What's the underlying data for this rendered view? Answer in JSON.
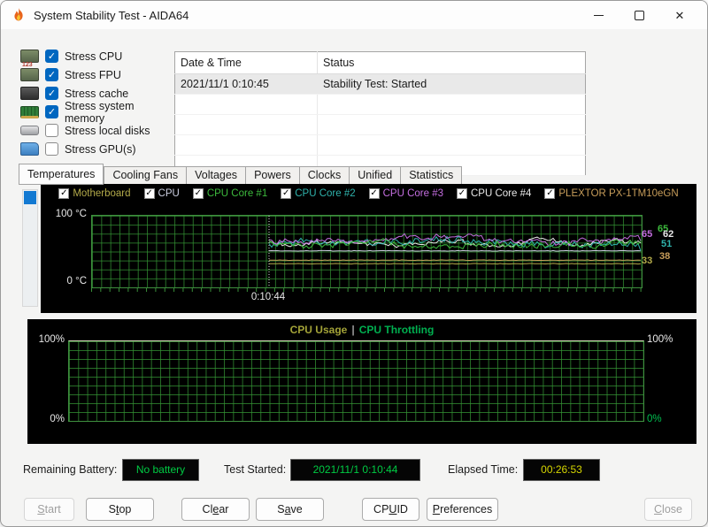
{
  "window": {
    "title": "System Stability Test - AIDA64"
  },
  "glyphs": {
    "check": "✓",
    "close": "✕"
  },
  "colors": {
    "accent_blue": "#0067c0",
    "panel_bg": "#000000",
    "grid_green": "#349434",
    "usage_title_olive": "#a3a338",
    "throttling_green": "#00b050",
    "status_value_green": "#00cc44",
    "status_value_yellow": "#d6d600"
  },
  "stress_options": [
    {
      "label": "Stress CPU",
      "checked": true,
      "icon": "cpu-icon"
    },
    {
      "label": "Stress FPU",
      "checked": true,
      "icon": "fpu-icon"
    },
    {
      "label": "Stress cache",
      "checked": true,
      "icon": "cache-icon"
    },
    {
      "label": "Stress system memory",
      "checked": true,
      "icon": "memory-icon"
    },
    {
      "label": "Stress local disks",
      "checked": false,
      "icon": "disk-icon"
    },
    {
      "label": "Stress GPU(s)",
      "checked": false,
      "icon": "gpu-icon"
    }
  ],
  "log_table": {
    "columns": [
      "Date & Time",
      "Status"
    ],
    "rows": [
      {
        "datetime": "2021/11/1 0:10:45",
        "status": "Stability Test: Started",
        "selected": true
      }
    ]
  },
  "tabs": {
    "active": "Temperatures",
    "items": [
      "Temperatures",
      "Cooling Fans",
      "Voltages",
      "Powers",
      "Clocks",
      "Unified",
      "Statistics"
    ]
  },
  "chart_data": [
    {
      "type": "line",
      "title": "Temperatures",
      "y_axis": {
        "max_label": "100 °C",
        "min_label": "0 °C",
        "min": 0,
        "max": 100
      },
      "x_axis": {
        "start_marker": "0:10:44"
      },
      "legend_position": "top",
      "grid": true,
      "legend": [
        {
          "label": "Motherboard",
          "color": "#b3aa4a",
          "checked": true
        },
        {
          "label": "CPU",
          "color": "#cdd0e2",
          "checked": true
        },
        {
          "label": "CPU Core #1",
          "color": "#3dbb3d",
          "checked": true
        },
        {
          "label": "CPU Core #2",
          "color": "#2fb3ac",
          "checked": true
        },
        {
          "label": "CPU Core #3",
          "color": "#c46ee0",
          "checked": true
        },
        {
          "label": "CPU Core #4",
          "color": "#e8e8e8",
          "checked": true
        },
        {
          "label": "PLEXTOR PX-1TM10eGN",
          "color": "#c79d5a",
          "checked": true
        }
      ],
      "series": [
        {
          "name": "Motherboard",
          "color": "#b3aa4a",
          "pattern": "flat",
          "value": 33,
          "end": 33
        },
        {
          "name": "CPU",
          "color": "#cdd0e2",
          "pattern": "flat",
          "value": 51,
          "end": 51
        },
        {
          "name": "CPU Core #1",
          "color": "#3dbb3d",
          "pattern": "noisy",
          "mean": 64,
          "amplitude": 7,
          "end": 65
        },
        {
          "name": "CPU Core #2",
          "color": "#2fb3ac",
          "pattern": "noisy",
          "mean": 61,
          "amplitude": 7,
          "end": 51
        },
        {
          "name": "CPU Core #3",
          "color": "#c46ee0",
          "pattern": "noisy",
          "mean": 66,
          "amplitude": 6,
          "end": 65
        },
        {
          "name": "CPU Core #4",
          "color": "#e8e8e8",
          "pattern": "noisy",
          "mean": 63,
          "amplitude": 5,
          "end": 62
        },
        {
          "name": "PLEXTOR PX-1TM10eGN",
          "color": "#c79d5a",
          "pattern": "flat",
          "value": 38,
          "end": 38
        }
      ],
      "end_labels": [
        {
          "text": "65",
          "color": "#c46ee0"
        },
        {
          "text": "65",
          "color": "#3dbb3d"
        },
        {
          "text": "62",
          "color": "#e8e8e8"
        },
        {
          "text": "51",
          "color": "#2fb3ac"
        },
        {
          "text": "38",
          "color": "#c79d5a"
        },
        {
          "text": "33",
          "color": "#b3aa4a"
        }
      ]
    },
    {
      "type": "line",
      "title_left": "CPU Usage",
      "title_separator": "|",
      "title_right": "CPU Throttling",
      "y_axis": {
        "max_label": "100%",
        "min_label": "0%",
        "min": 0,
        "max": 100
      },
      "grid": true,
      "series": [
        {
          "name": "CPU Usage",
          "color": "#d9d9bd",
          "pattern": "flat",
          "value": 100
        }
      ]
    }
  ],
  "status_bar": {
    "items": [
      {
        "label": "Remaining Battery:",
        "value": "No battery",
        "value_color": "#00cc44"
      },
      {
        "label": "Test Started:",
        "value": "2021/11/1 0:10:44",
        "value_color": "#00cc44"
      },
      {
        "label": "Elapsed Time:",
        "value": "00:26:53",
        "value_color": "#d6d600"
      }
    ]
  },
  "buttons": [
    {
      "label": "Start",
      "accel": 0,
      "enabled": false
    },
    {
      "label": "Stop",
      "accel": 1,
      "enabled": true
    },
    {
      "label": "Clear",
      "accel": 2,
      "enabled": true
    },
    {
      "label": "Save",
      "accel": 1,
      "enabled": true
    },
    {
      "label": "CPUID",
      "accel": 2,
      "enabled": true
    },
    {
      "label": "Preferences",
      "accel": 0,
      "enabled": true
    },
    {
      "label": "Close",
      "accel": 0,
      "enabled": false
    }
  ]
}
